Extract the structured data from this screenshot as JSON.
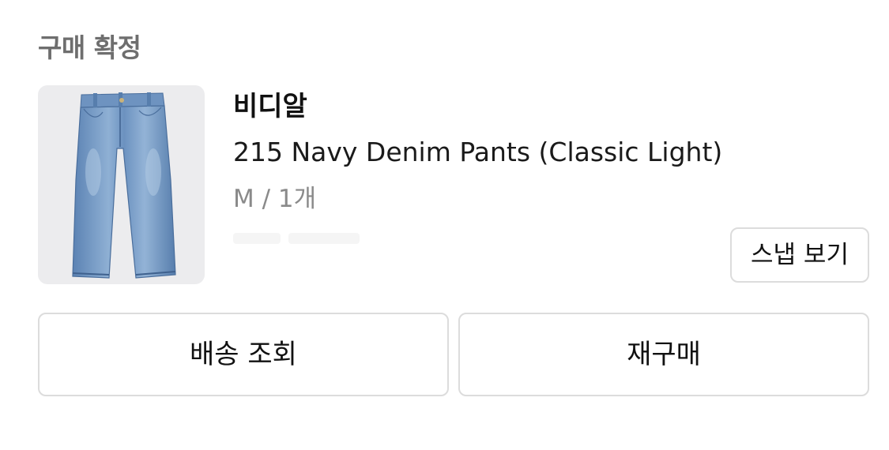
{
  "order": {
    "status_label": "구매 확정"
  },
  "product": {
    "brand": "비디알",
    "name": "215 Navy Denim Pants (Classic Light)",
    "option": "M / 1개",
    "image_icon": "denim-pants-image"
  },
  "buttons": {
    "snap_label": "스냅 보기",
    "delivery_label": "배송 조회",
    "reorder_label": "재구매"
  },
  "colors": {
    "denim_light": "#8fb0d4",
    "denim_mid": "#6c92c0",
    "denim_dark": "#4a6e9c",
    "thumb_bg": "#ececee",
    "border": "#dcdcdc",
    "muted_text": "#8a8a8a"
  }
}
